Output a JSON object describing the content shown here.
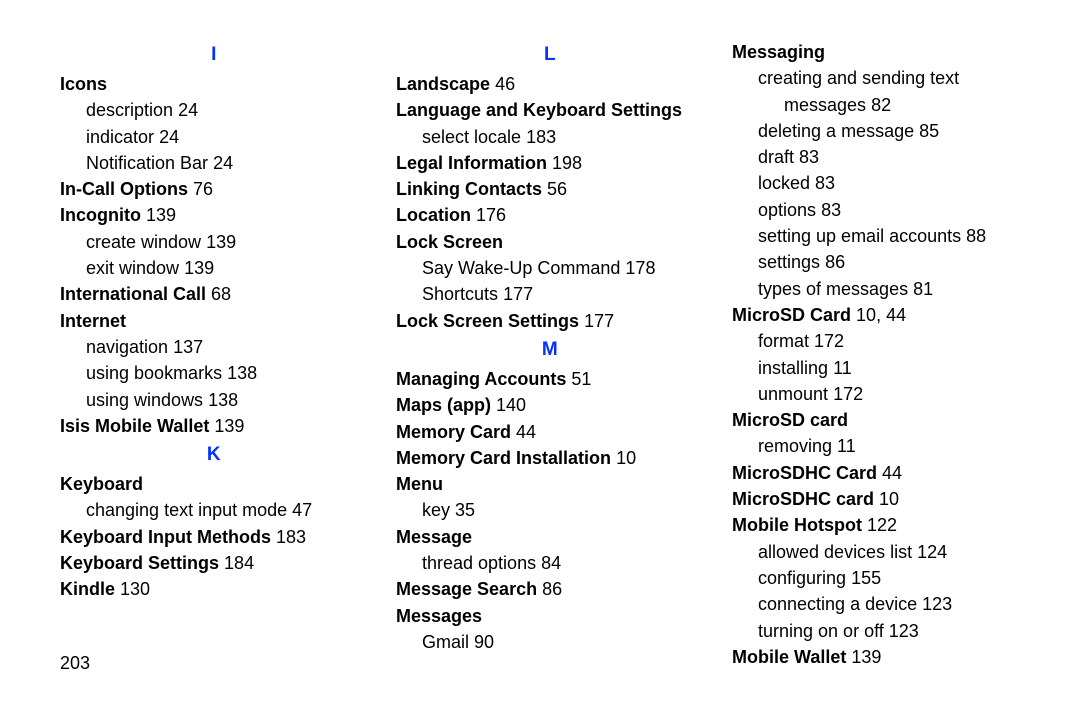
{
  "pageNumber": "203",
  "columns": [
    {
      "blocks": [
        {
          "type": "letter",
          "text": "I"
        },
        {
          "type": "topic",
          "text": "Icons"
        },
        {
          "type": "sub",
          "text": "description",
          "page": "24"
        },
        {
          "type": "sub",
          "text": "indicator",
          "page": "24"
        },
        {
          "type": "sub",
          "text": "Notification Bar",
          "page": "24"
        },
        {
          "type": "topic",
          "text": "In-Call Options",
          "page": "76"
        },
        {
          "type": "topic",
          "text": "Incognito",
          "page": "139"
        },
        {
          "type": "sub",
          "text": "create window",
          "page": "139"
        },
        {
          "type": "sub",
          "text": "exit window",
          "page": "139"
        },
        {
          "type": "topic",
          "text": "International Call",
          "page": "68"
        },
        {
          "type": "topic",
          "text": "Internet"
        },
        {
          "type": "sub",
          "text": "navigation",
          "page": "137"
        },
        {
          "type": "sub",
          "text": "using bookmarks",
          "page": "138"
        },
        {
          "type": "sub",
          "text": "using windows",
          "page": "138"
        },
        {
          "type": "topic",
          "text": "Isis Mobile Wallet",
          "page": "139"
        },
        {
          "type": "letter",
          "text": "K"
        },
        {
          "type": "topic",
          "text": "Keyboard"
        },
        {
          "type": "sub",
          "text": "changing text input mode",
          "page": "47"
        },
        {
          "type": "topic",
          "text": "Keyboard Input Methods",
          "page": "183"
        },
        {
          "type": "topic",
          "text": "Keyboard Settings",
          "page": "184"
        },
        {
          "type": "topic",
          "text": "Kindle",
          "page": "130"
        }
      ]
    },
    {
      "blocks": [
        {
          "type": "letter",
          "text": "L"
        },
        {
          "type": "topic",
          "text": "Landscape",
          "page": "46"
        },
        {
          "type": "topic",
          "text": "Language and Keyboard Settings"
        },
        {
          "type": "sub",
          "text": "select locale",
          "page": "183"
        },
        {
          "type": "topic",
          "text": "Legal Information",
          "page": "198"
        },
        {
          "type": "topic",
          "text": "Linking Contacts",
          "page": "56"
        },
        {
          "type": "topic",
          "text": "Location",
          "page": "176"
        },
        {
          "type": "topic",
          "text": "Lock Screen"
        },
        {
          "type": "sub",
          "text": "Say Wake-Up Command",
          "page": "178"
        },
        {
          "type": "sub",
          "text": "Shortcuts",
          "page": "177"
        },
        {
          "type": "topic",
          "text": "Lock Screen Settings",
          "page": "177"
        },
        {
          "type": "letter",
          "text": "M"
        },
        {
          "type": "topic",
          "text": "Managing Accounts",
          "page": "51"
        },
        {
          "type": "topic",
          "text": "Maps (app)",
          "page": "140"
        },
        {
          "type": "topic",
          "text": "Memory Card",
          "page": "44"
        },
        {
          "type": "topic",
          "text": "Memory Card Installation",
          "page": "10"
        },
        {
          "type": "topic",
          "text": "Menu"
        },
        {
          "type": "sub",
          "text": "key",
          "page": "35"
        },
        {
          "type": "topic",
          "text": "Message"
        },
        {
          "type": "sub",
          "text": "thread options",
          "page": "84"
        },
        {
          "type": "topic",
          "text": "Message Search",
          "page": "86"
        },
        {
          "type": "topic",
          "text": "Messages"
        },
        {
          "type": "sub",
          "text": "Gmail",
          "page": "90"
        }
      ]
    },
    {
      "blocks": [
        {
          "type": "topic",
          "text": "Messaging"
        },
        {
          "type": "sublines",
          "lines": [
            "creating and sending text",
            "messages"
          ],
          "page": "82"
        },
        {
          "type": "sub",
          "text": "deleting a message",
          "page": "85"
        },
        {
          "type": "sub",
          "text": "draft",
          "page": "83"
        },
        {
          "type": "sub",
          "text": "locked",
          "page": "83"
        },
        {
          "type": "sub",
          "text": "options",
          "page": "83"
        },
        {
          "type": "sub",
          "text": "setting up email accounts",
          "page": "88"
        },
        {
          "type": "sub",
          "text": "settings",
          "page": "86"
        },
        {
          "type": "sub",
          "text": "types of messages",
          "page": "81"
        },
        {
          "type": "topic",
          "text": "MicroSD Card",
          "page": "10, 44"
        },
        {
          "type": "sub",
          "text": "format",
          "page": "172"
        },
        {
          "type": "sub",
          "text": "installing",
          "page": "11"
        },
        {
          "type": "sub",
          "text": "unmount",
          "page": "172"
        },
        {
          "type": "topic",
          "text": "MicroSD card"
        },
        {
          "type": "sub",
          "text": "removing",
          "page": "11"
        },
        {
          "type": "topic",
          "text": "MicroSDHC Card",
          "page": "44"
        },
        {
          "type": "topic",
          "text": "MicroSDHC card",
          "page": "10"
        },
        {
          "type": "topic",
          "text": "Mobile Hotspot",
          "page": "122"
        },
        {
          "type": "sub",
          "text": "allowed devices list",
          "page": "124"
        },
        {
          "type": "sub",
          "text": "configuring",
          "page": "155"
        },
        {
          "type": "sub",
          "text": "connecting a device",
          "page": "123"
        },
        {
          "type": "sub",
          "text": "turning on or off",
          "page": "123"
        },
        {
          "type": "topic",
          "text": "Mobile Wallet",
          "page": "139"
        }
      ]
    }
  ]
}
